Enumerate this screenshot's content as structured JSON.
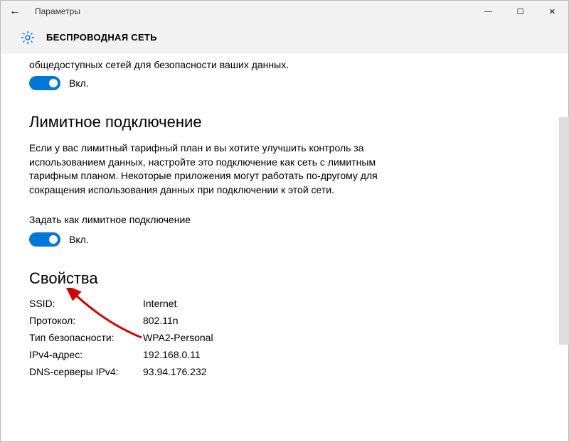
{
  "titlebar": {
    "back_icon": "←",
    "title": "Параметры",
    "min": "—",
    "max": "☐",
    "close": "✕"
  },
  "header": {
    "page_title": "БЕСПРОВОДНАЯ СЕТЬ"
  },
  "section_public": {
    "truncated": "общедоступных сетей для безопасности ваших данных.",
    "toggle_label": "Вкл."
  },
  "section_metered": {
    "title": "Лимитное подключение",
    "desc": "Если у вас лимитный тарифный план и вы хотите улучшить контроль за использованием данных, настройте это подключение как сеть с лимитным тарифным планом. Некоторые приложения могут работать по-другому для сокращения использования данных при подключении к этой сети.",
    "sub_label": "Задать как лимитное подключение",
    "toggle_label": "Вкл."
  },
  "section_props": {
    "title": "Свойства",
    "rows": [
      {
        "key": "SSID:",
        "val": "Internet"
      },
      {
        "key": "Протокол:",
        "val": "802.11n"
      },
      {
        "key": "Тип безопасности:",
        "val": "WPA2-Personal"
      },
      {
        "key": "IPv4-адрес:",
        "val": "192.168.0.11"
      },
      {
        "key": "DNS-серверы IPv4:",
        "val": "93.94.176.232"
      }
    ]
  }
}
